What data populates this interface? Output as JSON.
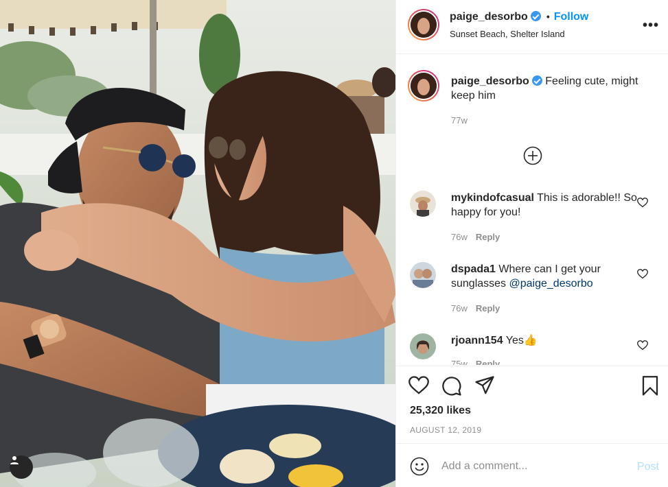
{
  "post": {
    "header": {
      "username": "paige_desorbo",
      "follow_label": "Follow",
      "separator": "•",
      "location": "Sunset Beach, Shelter Island",
      "more_icon": "more-horizontal-icon",
      "more_label": "•••"
    },
    "caption": {
      "username": "paige_desorbo",
      "text": "Feeling cute, might keep him",
      "age": "77w"
    },
    "load_more_icon": "plus-circle-icon",
    "comments": [
      {
        "username": "mykindofcasual",
        "text": "This is adorable!! So happy for you!",
        "age": "76w",
        "reply_label": "Reply"
      },
      {
        "username": "dspada1",
        "text": "Where can I get your sunglasses ",
        "mention": "@paige_desorbo",
        "age": "76w",
        "reply_label": "Reply"
      },
      {
        "username": "rjoann154",
        "text": "Yes👍",
        "age": "75w",
        "reply_label": "Reply"
      }
    ],
    "likes": "25,320 likes",
    "date": "AUGUST 12, 2019",
    "add_comment": {
      "placeholder": "Add a comment...",
      "post_label": "Post"
    }
  },
  "colors": {
    "accent": "#0095f6",
    "verified": "#3897f0",
    "post_disabled": "#b2dffc",
    "muted": "#8e8e8e",
    "text": "#262626"
  }
}
